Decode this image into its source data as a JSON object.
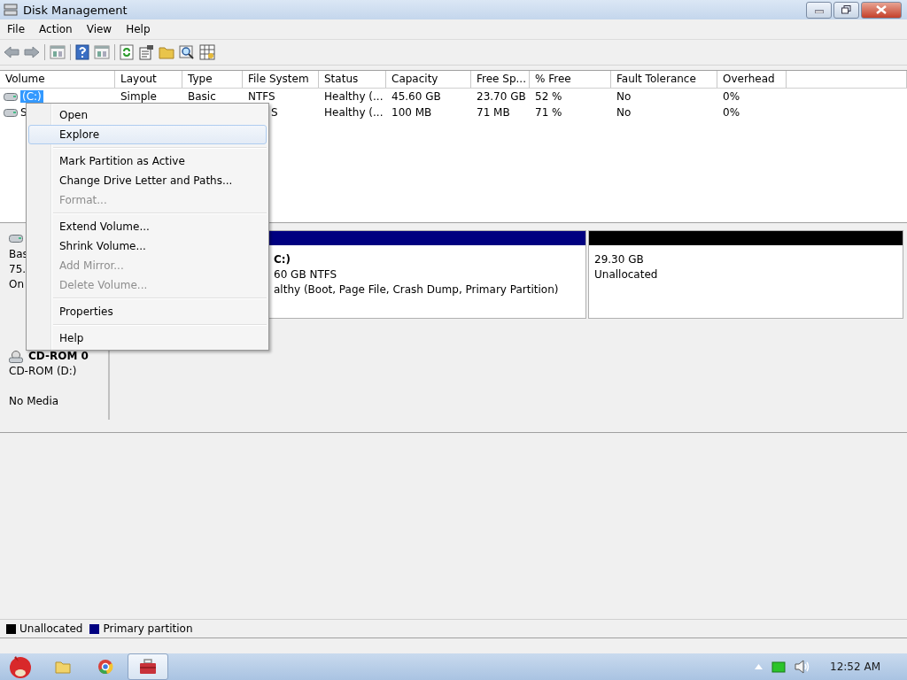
{
  "window": {
    "title": "Disk Management"
  },
  "menu_bar": [
    "File",
    "Action",
    "View",
    "Help"
  ],
  "toolbar": [
    {
      "kind": "back"
    },
    {
      "kind": "forward"
    },
    {
      "kind": "sep"
    },
    {
      "kind": "panel"
    },
    {
      "kind": "sep"
    },
    {
      "kind": "help"
    },
    {
      "kind": "panel"
    },
    {
      "kind": "sep"
    },
    {
      "kind": "refresh"
    },
    {
      "kind": "properties"
    },
    {
      "kind": "folder"
    },
    {
      "kind": "search"
    },
    {
      "kind": "grid"
    }
  ],
  "table": {
    "columns": [
      "Volume",
      "Layout",
      "Type",
      "File System",
      "Status",
      "Capacity",
      "Free Sp...",
      "% Free",
      "Fault Tolerance",
      "Overhead"
    ],
    "rows": [
      {
        "selected": true,
        "volume": "(C:)",
        "layout": "Simple",
        "type": "Basic",
        "file_system": "NTFS",
        "status": "Healthy (...",
        "capacity": "45.60 GB",
        "free_space": "23.70 GB",
        "percent_free": "52 %",
        "fault_tolerance": "No",
        "overhead": "0%"
      },
      {
        "selected": false,
        "volume": "S",
        "file_system": "S",
        "status": "Healthy (...",
        "capacity": "100 MB",
        "free_space": "71 MB",
        "percent_free": "71 %",
        "fault_tolerance": "No",
        "overhead": "0%"
      }
    ]
  },
  "disks": [
    {
      "kind": "basic",
      "lines": [
        "Bas",
        "75.",
        "On"
      ],
      "partitions": [
        {
          "name": "C:)",
          "lines": [
            "60 GB NTFS",
            "althy (Boot, Page File, Crash Dump, Primary Partition)"
          ],
          "color": "#000080"
        },
        {
          "lines": [
            "29.30 GB",
            "Unallocated"
          ],
          "color": "#000000"
        }
      ]
    },
    {
      "kind": "cdrom",
      "name": "CD-ROM 0",
      "lines": [
        "CD-ROM (D:)",
        "No Media"
      ]
    }
  ],
  "legend": [
    {
      "label": "Unallocated",
      "color": "#000000"
    },
    {
      "label": "Primary partition",
      "color": "#000080"
    }
  ],
  "context_menu": [
    {
      "kind": "item",
      "label": "Open",
      "disabled": false,
      "selected": false
    },
    {
      "kind": "item",
      "label": "Explore",
      "disabled": false,
      "selected": true
    },
    {
      "kind": "separator"
    },
    {
      "kind": "item",
      "label": "Mark Partition as Active",
      "disabled": false,
      "selected": false
    },
    {
      "kind": "item",
      "label": "Change Drive Letter and Paths...",
      "disabled": false,
      "selected": false
    },
    {
      "kind": "item",
      "label": "Format...",
      "disabled": true,
      "selected": false
    },
    {
      "kind": "separator"
    },
    {
      "kind": "item",
      "label": "Extend Volume...",
      "disabled": false,
      "selected": false
    },
    {
      "kind": "item",
      "label": "Shrink Volume...",
      "disabled": false,
      "selected": false
    },
    {
      "kind": "item",
      "label": "Add Mirror...",
      "disabled": true,
      "selected": false
    },
    {
      "kind": "item",
      "label": "Delete Volume...",
      "disabled": true,
      "selected": false
    },
    {
      "kind": "separator"
    },
    {
      "kind": "item",
      "label": "Properties",
      "disabled": false,
      "selected": false
    },
    {
      "kind": "separator"
    },
    {
      "kind": "item",
      "label": "Help",
      "disabled": false,
      "selected": false
    }
  ],
  "taskbar": {
    "buttons": [
      {
        "kind": "folder",
        "selected": false
      },
      {
        "kind": "browser",
        "selected": false
      },
      {
        "kind": "disk-app",
        "selected": true
      }
    ],
    "clock": "12:52 AM"
  }
}
